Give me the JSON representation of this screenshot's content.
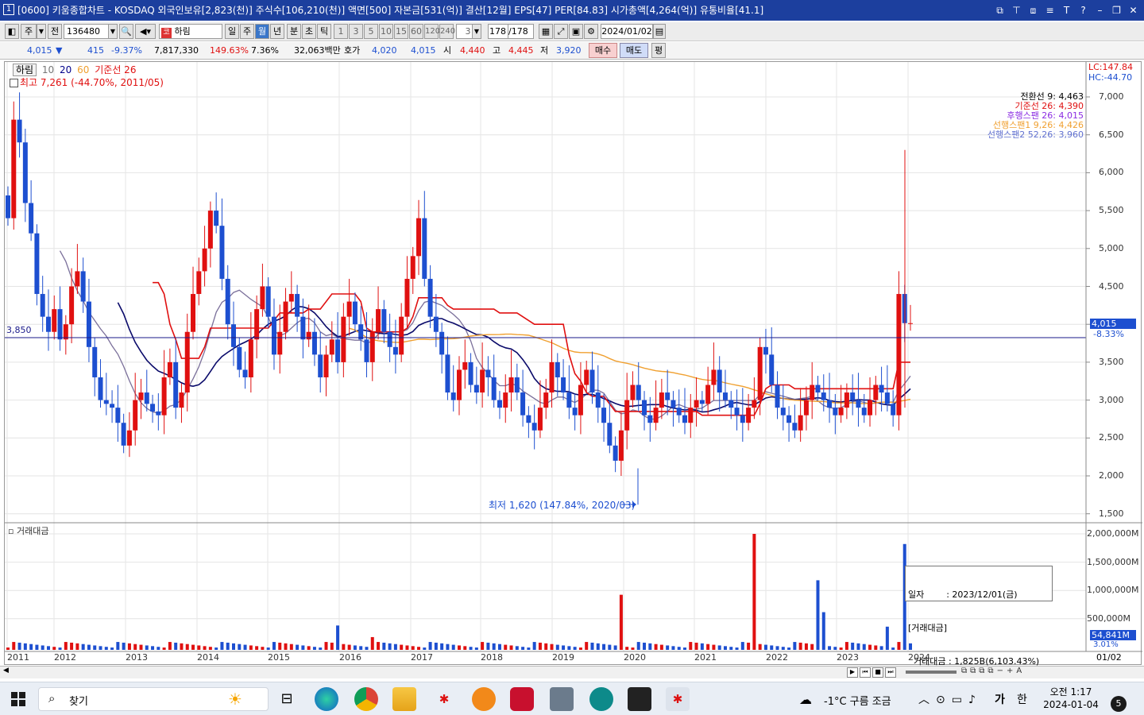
{
  "window": {
    "number": "1",
    "title": "[0600] 키움종합차트 - KOSDAQ 외국인보유[2,823(천)] 주식수[106,210(천)] 액면[500] 자본금[531(억)] 결산[12월] EPS[47] PER[84.83] 시가총액[4,264(억)] 유통비율[41.1]"
  },
  "toolbar": {
    "stock_prefix_1": "주",
    "stock_prefix_2": "전",
    "code": "136480",
    "name": "하림",
    "name_badge": "코",
    "period_labels": [
      "일",
      "주",
      "월",
      "년",
      "분",
      "초",
      "틱"
    ],
    "selected_period": "월",
    "interval_labels": [
      "1",
      "3",
      "5",
      "10",
      "15",
      "60",
      "120",
      "240"
    ],
    "interval_value": "3",
    "count": "178",
    "count_total": "/178",
    "date": "2024/01/02"
  },
  "quote": {
    "price": "4,015",
    "change": "415",
    "change_pct": "-9.37%",
    "volume": "7,817,330",
    "volume_pct": "149.63%",
    "turnover_pct": "7.36%",
    "amount": "32,063백만",
    "bid_label": "호가",
    "bid_1": "4,020",
    "bid_2": "4,015",
    "open_label": "시",
    "open": "4,440",
    "high_label": "고",
    "high": "4,445",
    "low_label": "저",
    "low": "3,920",
    "buy_label": "매수",
    "sell_label": "매도",
    "avg_label": "평"
  },
  "legend": {
    "name": "하림",
    "ma10": "10",
    "ma20": "20",
    "ma60": "60",
    "base_line": "기준선 26",
    "max_label": "최고 7,261 (-44.70%, 2011/05)",
    "min_label": "최저 1,620 (147.84%, 2020/03)",
    "lc": "LC:147.84",
    "hc": "HC:-44.70"
  },
  "ichimoku": [
    {
      "label": "전환선 9: 4,463",
      "color": "#000000"
    },
    {
      "label": "기준선 26: 4,390",
      "color": "#e01010"
    },
    {
      "label": "후행스팬 26: 4,015",
      "color": "#8a2be2"
    },
    {
      "label": "선행스팬1 9,26: 4,426",
      "color": "#f0a030"
    },
    {
      "label": "선행스팬2 52,26: 3,960",
      "color": "#6070d0"
    }
  ],
  "price_axis": {
    "ticks": [
      "7,000",
      "6,500",
      "6,000",
      "5,500",
      "5,000",
      "4,500",
      "4,000",
      "3,500",
      "3,000",
      "2,500",
      "2,000",
      "1,500"
    ],
    "current_tag": "4,015",
    "current_pct": "-8.33%",
    "hline_label": "3,850"
  },
  "volume_pane": {
    "title": "거래대금",
    "ticks": [
      "2,000,000M",
      "1,500,000M",
      "1,000,000M",
      "500,000M"
    ],
    "last_tag": "54,841M",
    "last_pct": "3.01%"
  },
  "tooltip": {
    "line1": "일자        : 2023/12/01(금)",
    "line2": "[거래대금]",
    "line3": "  거래대금 : 1,825B(6,103.43%)"
  },
  "x_axis": {
    "years": [
      "2011",
      "2012",
      "2013",
      "2014",
      "2015",
      "2016",
      "2017",
      "2018",
      "2019",
      "2020",
      "2021",
      "2022",
      "2023",
      "2024"
    ],
    "end_label": "01/02"
  },
  "chart_data": {
    "type": "candlestick",
    "x_range": [
      "2011/01",
      "2024/01"
    ],
    "ylim": [
      1500,
      7261
    ],
    "key_points": [
      {
        "date": "2011/05",
        "high": 7261
      },
      {
        "date": "2020/03",
        "low": 1620
      },
      {
        "date": "2024/01",
        "close": 4015,
        "open": 4440,
        "high": 4445,
        "low": 3920
      }
    ],
    "annotation_hline": 3850,
    "up_color": "#e01010",
    "down_color": "#1d4fd0"
  },
  "taskbar": {
    "search": "찾기",
    "weather": "-1°C  구름 조금",
    "ime": "가",
    "lang": "한",
    "time": "오전 1:17",
    "date": "2024-01-04",
    "notif": "5"
  }
}
